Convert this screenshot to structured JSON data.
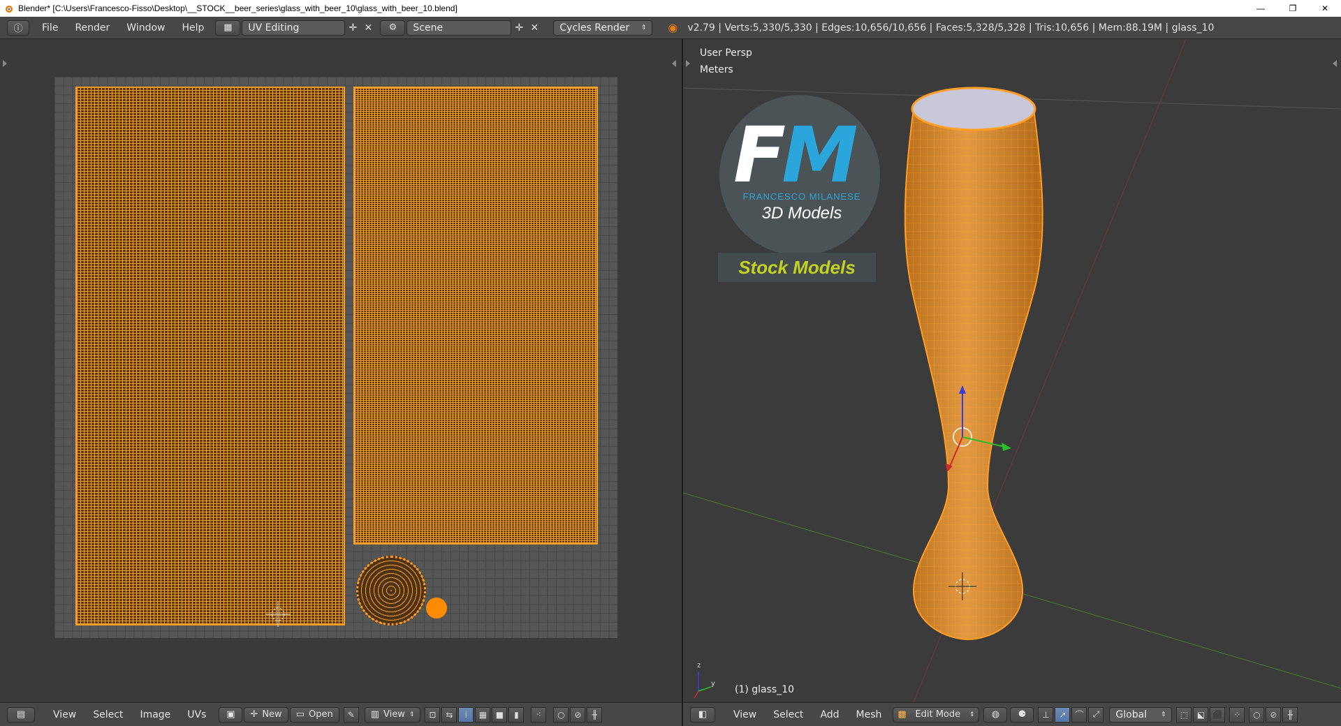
{
  "window": {
    "title": "Blender* [C:\\Users\\Francesco-Fisso\\Desktop\\__STOCK__beer_series\\glass_with_beer_10\\glass_with_beer_10.blend]",
    "minimize": "—",
    "maximize": "❐",
    "close": "✕"
  },
  "info_header": {
    "menus": [
      "File",
      "Render",
      "Window",
      "Help"
    ],
    "screen_layout": "UV Editing",
    "scene": "Scene",
    "render_engine": "Cycles Render",
    "stats": "v2.79 | Verts:5,330/5,330 | Edges:10,656/10,656 | Faces:5,328/5,328 | Tris:10,656 | Mem:88.19M | glass_10"
  },
  "uv_editor": {
    "header_menus": [
      "View",
      "Select",
      "Image",
      "UVs"
    ],
    "new_label": "New",
    "open_label": "Open",
    "view_label": "View"
  },
  "viewport": {
    "perspective_label": "User Persp",
    "units_label": "Meters",
    "object_label": "(1) glass_10",
    "header_menus": [
      "View",
      "Select",
      "Add",
      "Mesh"
    ],
    "mode": "Edit Mode",
    "orientation": "Global",
    "logo": {
      "initials_f": "F",
      "initials_m": "M",
      "name": "FRANCESCO MILANESE",
      "subtitle": "3D Models",
      "badge": "Stock Models"
    }
  },
  "colors": {
    "accent_orange": "#ff9d24",
    "logo_blue": "#2aa6dd",
    "logo_yellow": "#c4d31f"
  }
}
